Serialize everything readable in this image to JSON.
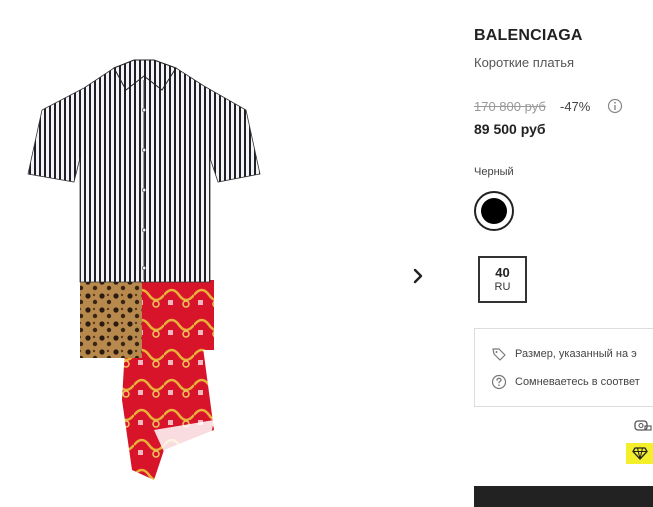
{
  "product": {
    "brand": "BALENCIAGA",
    "category": "Короткие платья",
    "old_price": "170 800 руб",
    "discount": "-47%",
    "price": "89 500 руб"
  },
  "color": {
    "label": "Черный",
    "swatch_hex": "#000000"
  },
  "size": {
    "value": "40",
    "system": "RU"
  },
  "notices": [
    {
      "icon": "tag-icon",
      "text": "Размер, указанный на э"
    },
    {
      "icon": "question-circle-icon",
      "text": "Сомневаетесь в соответ"
    }
  ],
  "icons": {
    "next": "chevron-right-icon",
    "info": "info-circle-icon",
    "measure": "measuring-tape-icon",
    "badge": "diamond-icon"
  },
  "colors": {
    "badge_bg": "#f3ef2a",
    "button_bg": "#222222"
  }
}
